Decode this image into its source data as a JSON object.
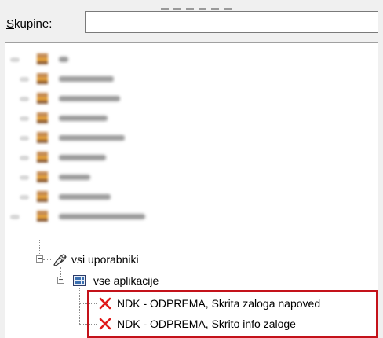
{
  "groups_label_prefix": "S",
  "groups_label_rest": "kupine:",
  "groups_input_value": "",
  "tree": {
    "blurred_rows": [
      {
        "width": 12
      },
      {
        "width": 70
      },
      {
        "width": 78
      },
      {
        "width": 62
      },
      {
        "width": 84
      },
      {
        "width": 60
      },
      {
        "width": 40
      },
      {
        "width": 66
      },
      {
        "width": 110
      }
    ],
    "users_node": {
      "label": "vsi uporabniki",
      "icon": "users-icon",
      "expander": "−"
    },
    "apps_node": {
      "label": "vse aplikacije",
      "icon": "applications-icon",
      "expander": "−"
    },
    "items": [
      {
        "label": "NDK - ODPREMA, Skrita zaloga napoved",
        "icon": "red-x-icon"
      },
      {
        "label": "NDK - ODPREMA, Skrito info zaloge",
        "icon": "red-x-icon"
      }
    ]
  },
  "colors": {
    "highlight": "#c4121a",
    "x_icon": "#e01919"
  }
}
